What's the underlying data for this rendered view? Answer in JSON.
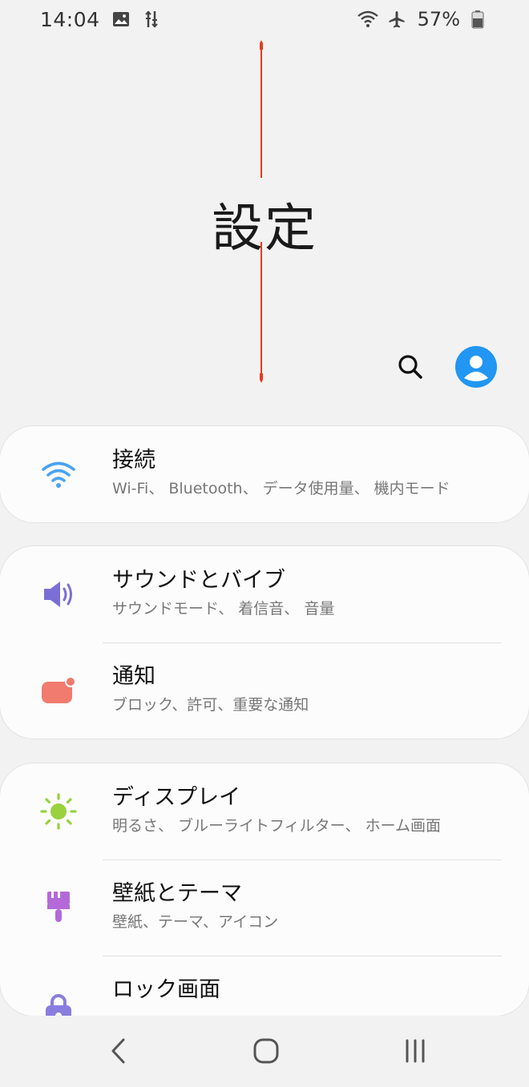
{
  "status_bar": {
    "time": "14:04",
    "battery_text": "57%",
    "icons": [
      "image-icon",
      "data-saver-icon",
      "wifi-calling-icon",
      "airplane-icon",
      "battery-icon"
    ]
  },
  "header": {
    "title": "設定",
    "actions": [
      "search-icon",
      "account-icon"
    ]
  },
  "colors": {
    "accent_arrow": "#e8391c",
    "account_blue": "#2196f3",
    "wifi_blue": "#4aa3f0",
    "sound_purple": "#7b6fd6",
    "notif_red": "#f07b6e",
    "display_green": "#9ad13f",
    "theme_purple": "#b36ad8",
    "lock_purple": "#8a7de0"
  },
  "groups": [
    {
      "items": [
        {
          "icon": "wifi-icon",
          "title": "接続",
          "subtitle": "Wi-Fi、 Bluetooth、 データ使用量、 機内モード"
        }
      ]
    },
    {
      "items": [
        {
          "icon": "speaker-icon",
          "title": "サウンドとバイブ",
          "subtitle": "サウンドモード、 着信音、 音量"
        },
        {
          "icon": "notification-icon",
          "title": "通知",
          "subtitle": "ブロック、許可、重要な通知"
        }
      ]
    },
    {
      "items": [
        {
          "icon": "brightness-icon",
          "title": "ディスプレイ",
          "subtitle": "明るさ、 ブルーライトフィルター、 ホーム画面"
        },
        {
          "icon": "paintbrush-icon",
          "title": "壁紙とテーマ",
          "subtitle": "壁紙、テーマ、アイコン"
        },
        {
          "icon": "lock-icon",
          "title": "ロック画面",
          "subtitle": ""
        }
      ]
    }
  ],
  "nav_bar": [
    "back-icon",
    "home-icon",
    "recents-icon"
  ]
}
